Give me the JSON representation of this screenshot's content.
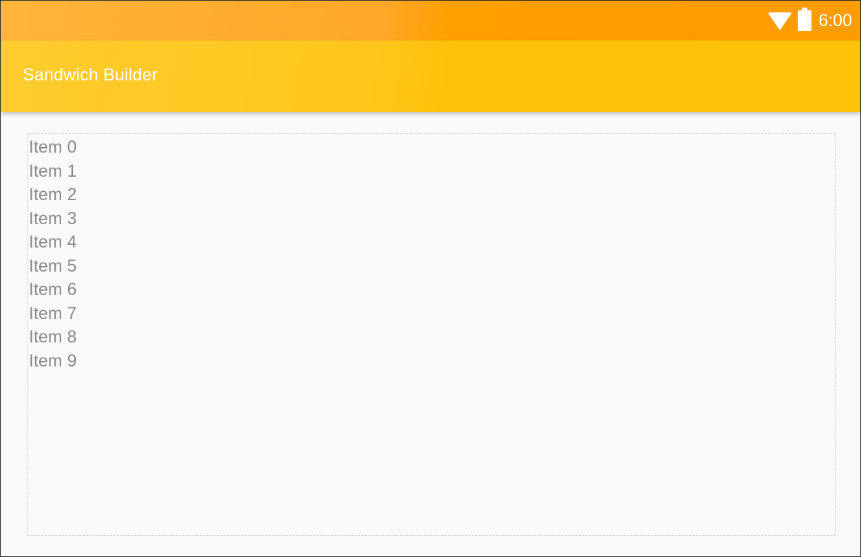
{
  "status_bar": {
    "time": "6:00",
    "icons": [
      "wifi-icon",
      "battery-icon"
    ]
  },
  "app_bar": {
    "title": "Sandwich Builder"
  },
  "list": {
    "items": [
      {
        "label": "Item 0"
      },
      {
        "label": "Item 1"
      },
      {
        "label": "Item 2"
      },
      {
        "label": "Item 3"
      },
      {
        "label": "Item 4"
      },
      {
        "label": "Item 5"
      },
      {
        "label": "Item 6"
      },
      {
        "label": "Item 7"
      },
      {
        "label": "Item 8"
      },
      {
        "label": "Item 9"
      }
    ]
  },
  "colors": {
    "status_bar": "#ffa000",
    "app_bar": "#ffc107",
    "title_text": "#ffffff",
    "item_text": "#8a8a8a",
    "background": "#fafafa"
  }
}
